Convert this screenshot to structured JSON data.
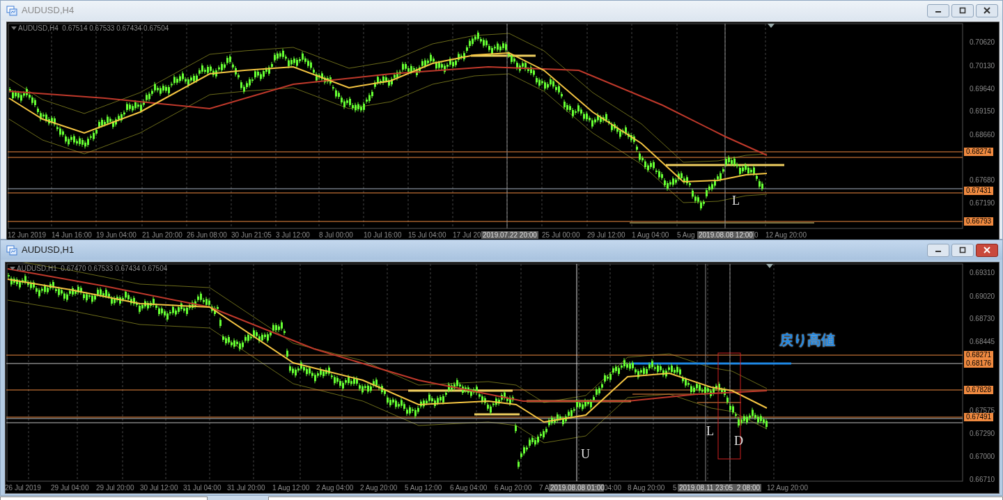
{
  "windows": [
    {
      "title": "AUDUSD,H4",
      "active": false,
      "legend": "AUDUSD,H4  0.67514 0.67533 0.67434 0.67504",
      "price_labels": [
        "0.70620",
        "0.70130",
        "0.69640",
        "0.69150",
        "0.68660",
        "0.67680",
        "0.67190"
      ],
      "price_markers": [
        "0.68274",
        "0.67431",
        "0.66793"
      ],
      "time_labels": [
        {
          "text": "12 Jun 2019",
          "highlighted": false
        },
        {
          "text": "14 Jun 16:00",
          "highlighted": false
        },
        {
          "text": "19 Jun 04:00",
          "highlighted": false
        },
        {
          "text": "21 Jun 20:00",
          "highlighted": false
        },
        {
          "text": "26 Jun 08:00",
          "highlighted": false
        },
        {
          "text": "30 Jun 21:05",
          "highlighted": false
        },
        {
          "text": "3 Jul 12:00",
          "highlighted": false
        },
        {
          "text": "8 Jul 00:00",
          "highlighted": false
        },
        {
          "text": "10 Jul 16:00",
          "highlighted": false
        },
        {
          "text": "15 Jul 04:00",
          "highlighted": false
        },
        {
          "text": "17 Jul 20",
          "highlighted": false
        },
        {
          "text": "2019.07.22 20:00",
          "highlighted": true
        },
        {
          "text": "25 Jul 00:00",
          "highlighted": false
        },
        {
          "text": "29 Jul 12:00",
          "highlighted": false
        },
        {
          "text": "1 Aug 04:00",
          "highlighted": false
        },
        {
          "text": "5 Aug",
          "highlighted": false
        },
        {
          "text": "2019.08.08 12:00",
          "highlighted": true
        },
        {
          "text": "0",
          "highlighted": false
        },
        {
          "text": "12 Aug 20:00",
          "highlighted": false
        }
      ],
      "annotations": [
        {
          "text": "L",
          "kind": "letter"
        }
      ]
    },
    {
      "title": "AUDUSD,H1",
      "active": true,
      "legend": "AUDUSD,H1  0.67470 0.67533 0.67434 0.67504",
      "price_labels": [
        "0.69310",
        "0.69020",
        "0.68730",
        "0.68445",
        "0.67575",
        "0.67290",
        "0.67000",
        "0.66710"
      ],
      "price_markers": [
        "0.68271",
        "0.68176",
        "0.67828",
        "0.67491"
      ],
      "time_labels": [
        {
          "text": "26 Jul 2019",
          "highlighted": false
        },
        {
          "text": "29 Jul 04:00",
          "highlighted": false
        },
        {
          "text": "29 Jul 20:00",
          "highlighted": false
        },
        {
          "text": "30 Jul 12:00",
          "highlighted": false
        },
        {
          "text": "31 Jul 04:00",
          "highlighted": false
        },
        {
          "text": "31 Jul 20:00",
          "highlighted": false
        },
        {
          "text": "1 Aug 12:00",
          "highlighted": false
        },
        {
          "text": "2 Aug 04:00",
          "highlighted": false
        },
        {
          "text": "2 Aug 20:00",
          "highlighted": false
        },
        {
          "text": "5 Aug 12:00",
          "highlighted": false
        },
        {
          "text": "6 Aug 04:00",
          "highlighted": false
        },
        {
          "text": "6 Aug 20:00",
          "highlighted": false
        },
        {
          "text": "7 A",
          "highlighted": false
        },
        {
          "text": "2019.08.08 01:00",
          "highlighted": true
        },
        {
          "text": "04:00",
          "highlighted": false
        },
        {
          "text": "8 Aug 20:00",
          "highlighted": false
        },
        {
          "text": "5",
          "highlighted": false
        },
        {
          "text": "2019.08.11 23:05  2 08:00",
          "highlighted": true
        },
        {
          "text": "12 Aug 20:00",
          "highlighted": false
        }
      ],
      "annotations": [
        {
          "text": "戻り高値",
          "kind": "callout"
        },
        {
          "text": "U",
          "kind": "letter"
        },
        {
          "text": "L",
          "kind": "letter"
        },
        {
          "text": "D",
          "kind": "letter"
        }
      ]
    }
  ]
}
